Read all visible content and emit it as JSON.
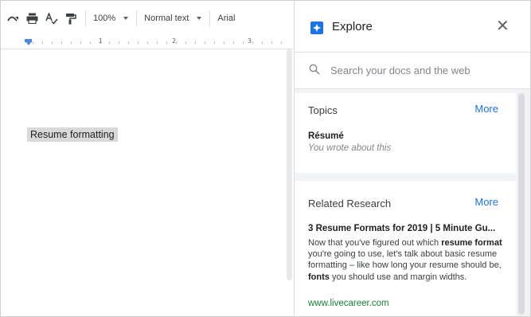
{
  "toolbar": {
    "zoom": "100%",
    "style": "Normal text",
    "font": "Arial",
    "icons": [
      "redo-icon",
      "print-icon",
      "spellcheck-icon",
      "paint-format-icon"
    ]
  },
  "ruler": {
    "marks": [
      "1",
      "2",
      "3"
    ]
  },
  "document": {
    "selected_text": "Resume formatting"
  },
  "explore": {
    "title": "Explore",
    "search_placeholder": "Search your docs and the web",
    "topics": {
      "heading": "Topics",
      "more": "More",
      "item_title": "Résumé",
      "item_subtitle": "You wrote about this"
    },
    "research": {
      "heading": "Related Research",
      "more": "More",
      "result_title": "3 Resume Formats for 2019 | 5 Minute Gu...",
      "snippet": {
        "p1": "Now that you've figured out which ",
        "b1": "resume format",
        "p2": " you're going to use, let's talk about basic resume formatting – like how long your resume should be, ",
        "b2": "fonts",
        "p3": " you should use and margin widths."
      },
      "url": "www.livecareer.com"
    }
  },
  "colors": {
    "accent": "#1a73e8",
    "url_green": "#188038",
    "selection": "#d9d9d9"
  }
}
